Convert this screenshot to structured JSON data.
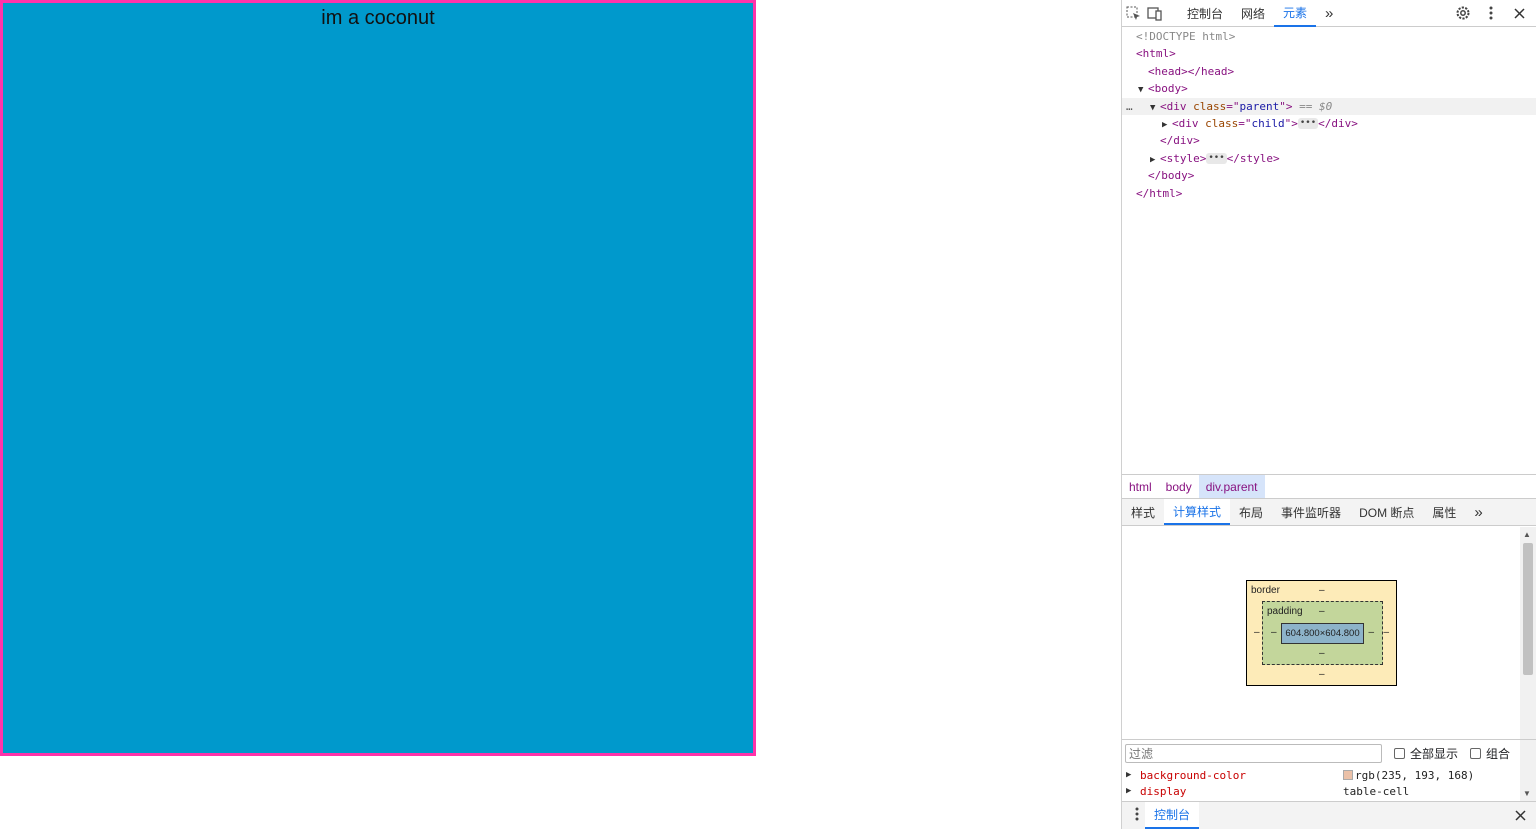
{
  "page": {
    "content_text": "im a coconut",
    "parent_bg": "#0099cc",
    "parent_border": "#ff33aa"
  },
  "devtools": {
    "toolbar": {
      "icons": [
        "inspect-element-icon",
        "device-toggle-icon"
      ],
      "tabs": [
        "控制台",
        "网络",
        "元素"
      ],
      "active_tab": "元素",
      "more": "»",
      "right_icons": [
        "settings-icon",
        "more-vert-icon",
        "close-icon"
      ]
    },
    "dom": {
      "doctype": "<!DOCTYPE html>",
      "html_open": "<html>",
      "head": "<head></head>",
      "body_open": "<body>",
      "parent_div": {
        "tag": "div",
        "attr": "class",
        "value": "parent",
        "eq": "== $0"
      },
      "child_div": {
        "tag": "div",
        "attr": "class",
        "value": "child"
      },
      "div_close": "</div>",
      "style_open": "<style>",
      "style_close": "</style>",
      "body_close": "</body>",
      "html_close": "</html>"
    },
    "breadcrumbs": [
      "html",
      "body",
      "div.parent"
    ],
    "subtabs": [
      "样式",
      "计算样式",
      "布局",
      "事件监听器",
      "DOM 断点",
      "属性"
    ],
    "active_subtab": "计算样式",
    "boxmodel": {
      "border_label": "border",
      "padding_label": "padding",
      "dash": "–",
      "content_size": "604.800×604.800"
    },
    "filter": {
      "placeholder": "过滤",
      "show_all": "全部显示",
      "group": "组合"
    },
    "properties": [
      {
        "name": "background-color",
        "value": "rgb(235, 193, 168)",
        "swatch": "#ebc1a8"
      },
      {
        "name": "display",
        "value": "table-cell"
      }
    ],
    "drawer": {
      "tab": "控制台"
    }
  }
}
